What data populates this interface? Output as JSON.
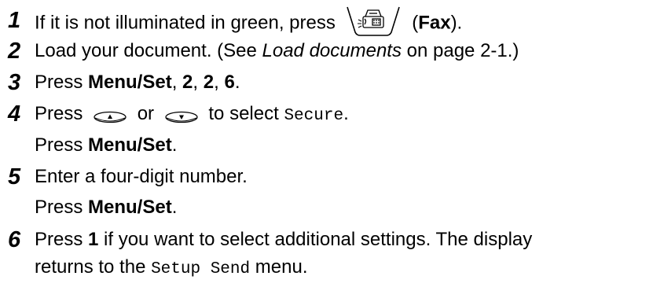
{
  "steps": [
    {
      "number": "1",
      "lines": [
        {
          "pre": "If it is not illuminated in green, press",
          "button": "fax-button-icon",
          "post_open": "(",
          "post_bold": "Fax",
          "post_close": ")."
        }
      ]
    },
    {
      "number": "2",
      "lines": [
        {
          "pre": "Load your document. (See ",
          "italic": "Load documents",
          "post": " on page 2-1.)"
        }
      ]
    },
    {
      "number": "3",
      "lines": [
        {
          "pre": "Press ",
          "b1": "Menu/Set",
          "s1": ", ",
          "b2": "2",
          "s2": ", ",
          "b3": "2",
          "s3": ", ",
          "b4": "6",
          "end": "."
        }
      ]
    },
    {
      "number": "4",
      "lines": [
        {
          "pre": "Press",
          "up_icon": "up-arrow-button-icon",
          "mid": "or",
          "down_icon": "down-arrow-button-icon",
          "post": "to select ",
          "mono": "Secure",
          "end": "."
        },
        {
          "pre": "Press ",
          "bold": "Menu/Set",
          "end": "."
        }
      ]
    },
    {
      "number": "5",
      "lines": [
        {
          "text": "Enter a four-digit number."
        },
        {
          "pre": "Press ",
          "bold": "Menu/Set",
          "end": "."
        }
      ]
    },
    {
      "number": "6",
      "lines": [
        {
          "pre": "Press ",
          "bold": "1",
          "post": " if you want to select additional settings. The display"
        },
        {
          "pre": "returns to the ",
          "mono": "Setup Send",
          "post": " menu."
        }
      ]
    }
  ]
}
